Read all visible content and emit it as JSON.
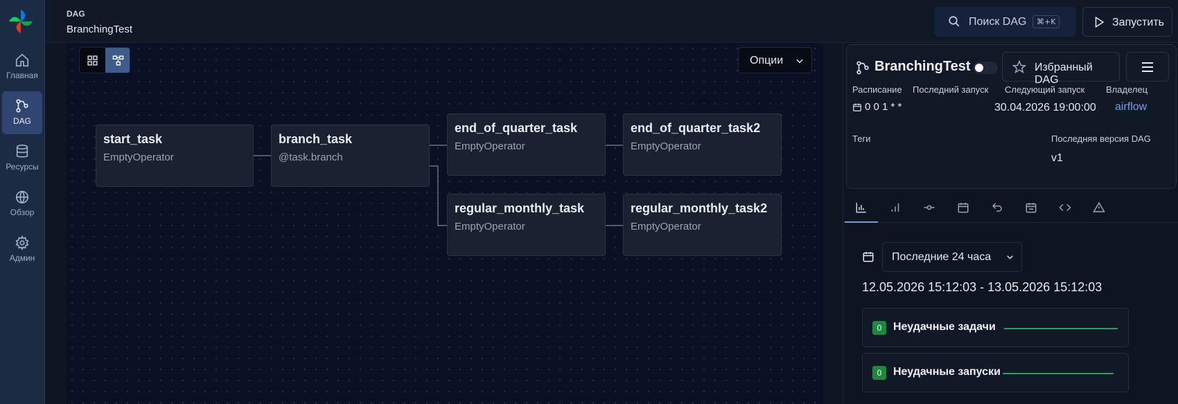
{
  "sidebar": {
    "items": [
      {
        "label": "Главная",
        "icon": "home-icon"
      },
      {
        "label": "DAG",
        "icon": "dag-icon",
        "active": true
      },
      {
        "label": "Ресурсы",
        "icon": "database-icon"
      },
      {
        "label": "Обзор",
        "icon": "globe-icon"
      },
      {
        "label": "Админ",
        "icon": "gear-icon"
      }
    ]
  },
  "header": {
    "crumb_small": "DAG",
    "crumb_title": "BranchingTest",
    "search_label": "Поиск DAG",
    "search_shortcut": "⌘+K",
    "run_label": "Запустить"
  },
  "graph": {
    "options_label": "Опции",
    "nodes": [
      {
        "name": "start_task",
        "operator": "EmptyOperator"
      },
      {
        "name": "branch_task",
        "operator": "@task.branch"
      },
      {
        "name": "end_of_quarter_task",
        "operator": "EmptyOperator"
      },
      {
        "name": "end_of_quarter_task2",
        "operator": "EmptyOperator"
      },
      {
        "name": "regular_monthly_task",
        "operator": "EmptyOperator"
      },
      {
        "name": "regular_monthly_task2",
        "operator": "EmptyOperator"
      }
    ]
  },
  "details": {
    "dag_name": "BranchingTest",
    "favorite_label": "Избранный DAG",
    "schedule_label": "Расписание",
    "schedule_value": "0 0 1 * *",
    "last_run_label": "Последний запуск",
    "next_run_label": "Следующий запуск",
    "next_run_value": "30.04.2026 19:00:00",
    "owner_label": "Владелец",
    "owner_value": "airflow",
    "tags_label": "Теги",
    "version_label": "Последняя версия DAG",
    "version_value": "v1"
  },
  "tabs": [
    "bar-chart-icon",
    "signal-icon",
    "commit-icon",
    "calendar-icon",
    "undo-icon",
    "calendar-check-icon",
    "code-icon",
    "warning-icon"
  ],
  "overview": {
    "range_select": "Последние 24 часа",
    "range_text": "12.05.2026 15:12:03 - 13.05.2026 15:12:03",
    "failed_tasks_count": "0",
    "failed_tasks_label": "Неудачные задачи",
    "failed_runs_count": "0",
    "failed_runs_label": "Неудачные запуски"
  },
  "colors": {
    "accent": "#3d5c8c",
    "success": "#1b8a3c",
    "link": "#6ea0e6"
  }
}
